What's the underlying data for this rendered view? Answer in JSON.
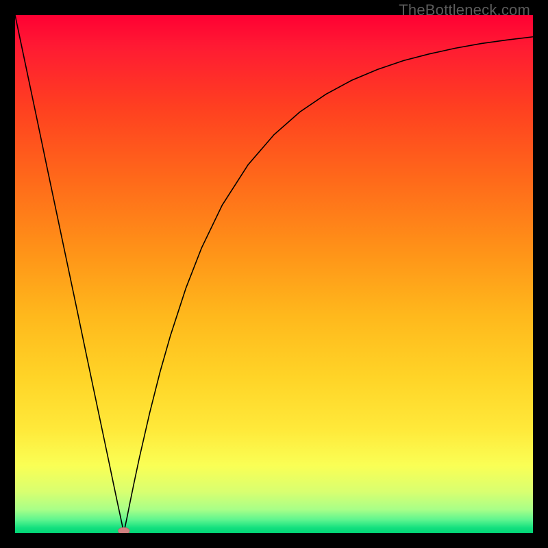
{
  "watermark": {
    "text": "TheBottleneck.com"
  },
  "chart_data": {
    "type": "line",
    "title": "",
    "xlabel": "",
    "ylabel": "",
    "xlim": [
      0,
      100
    ],
    "ylim": [
      0,
      100
    ],
    "grid": false,
    "legend": false,
    "background": {
      "type": "vertical-gradient",
      "stops": [
        {
          "pos": 0.0,
          "color": "#ff0033"
        },
        {
          "pos": 0.06,
          "color": "#ff1a33"
        },
        {
          "pos": 0.18,
          "color": "#ff4020"
        },
        {
          "pos": 0.32,
          "color": "#ff6a1a"
        },
        {
          "pos": 0.46,
          "color": "#ff9418"
        },
        {
          "pos": 0.58,
          "color": "#ffb81c"
        },
        {
          "pos": 0.7,
          "color": "#ffd427"
        },
        {
          "pos": 0.8,
          "color": "#ffe93a"
        },
        {
          "pos": 0.87,
          "color": "#faff55"
        },
        {
          "pos": 0.92,
          "color": "#d9ff70"
        },
        {
          "pos": 0.955,
          "color": "#a8ff88"
        },
        {
          "pos": 0.975,
          "color": "#5cf58f"
        },
        {
          "pos": 0.99,
          "color": "#14e07f"
        },
        {
          "pos": 1.0,
          "color": "#00d676"
        }
      ]
    },
    "series": [
      {
        "name": "curve",
        "color": "#000000",
        "width": 1.6,
        "x": [
          0.0,
          2.0,
          4.0,
          6.0,
          8.0,
          10.0,
          12.0,
          14.0,
          16.0,
          18.0,
          19.0,
          19.8,
          20.4,
          20.8,
          21.0,
          21.2,
          21.6,
          22.2,
          23.0,
          24.0,
          26.0,
          28.0,
          30.0,
          33.0,
          36.0,
          40.0,
          45.0,
          50.0,
          55.0,
          60.0,
          65.0,
          70.0,
          75.0,
          80.0,
          85.0,
          90.0,
          95.0,
          100.0
        ],
        "y": [
          100.0,
          90.5,
          81.0,
          71.4,
          61.9,
          52.4,
          42.9,
          33.3,
          23.8,
          14.3,
          9.5,
          5.7,
          2.9,
          1.0,
          0.0,
          1.0,
          2.9,
          5.9,
          9.8,
          14.5,
          23.2,
          31.1,
          38.1,
          47.3,
          55.0,
          63.3,
          71.1,
          76.9,
          81.3,
          84.7,
          87.4,
          89.5,
          91.2,
          92.5,
          93.6,
          94.5,
          95.2,
          95.8
        ]
      }
    ],
    "marker": {
      "x": 21.0,
      "y": 0.4,
      "rx": 1.1,
      "ry": 0.65,
      "fill": "#d18080",
      "stroke": "#b06a6a"
    }
  }
}
